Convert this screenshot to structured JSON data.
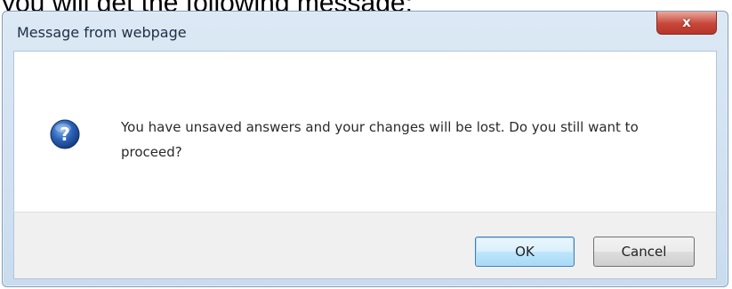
{
  "caption": "you will get the following message:",
  "dialog": {
    "title": "Message from webpage",
    "close_label": "x",
    "message": "You have unsaved answers and your changes will be lost. Do you still want to proceed?",
    "icon": "question-icon",
    "buttons": {
      "ok_label": "OK",
      "cancel_label": "Cancel"
    }
  },
  "colors": {
    "frame": "#c9dcee",
    "close_button": "#c7463a",
    "ok_button_border": "#3c7fb1",
    "question_icon": "#1f4f9e"
  }
}
